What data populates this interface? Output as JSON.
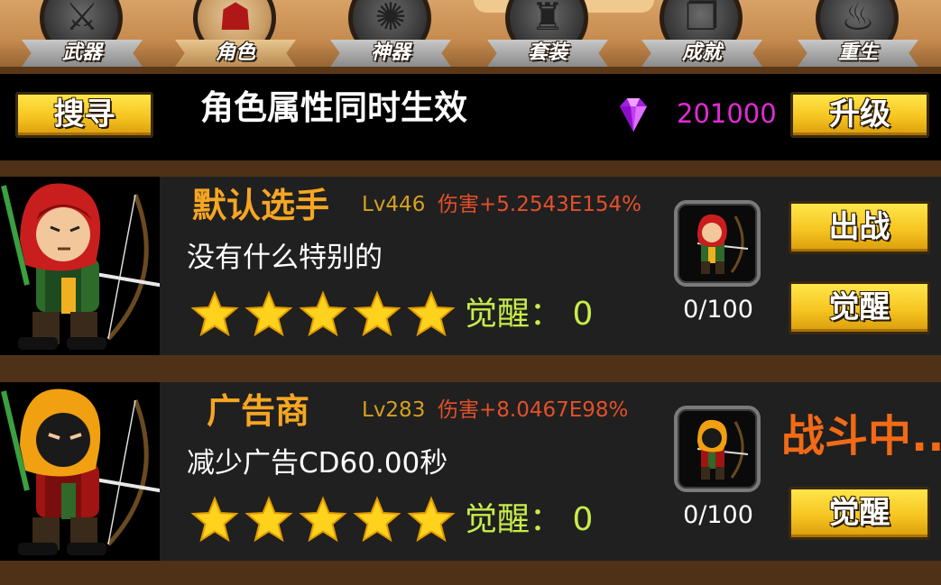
{
  "tabs": [
    {
      "label": "武器",
      "icon": "sword-icon",
      "active": false
    },
    {
      "label": "角色",
      "icon": "archer-icon",
      "active": true
    },
    {
      "label": "神器",
      "icon": "artifact-icon",
      "active": false
    },
    {
      "label": "套装",
      "icon": "helmet-icon",
      "active": false
    },
    {
      "label": "成就",
      "icon": "book-icon",
      "active": false
    },
    {
      "label": "重生",
      "icon": "fire-icon",
      "active": false
    }
  ],
  "header": {
    "search_label": "搜寻",
    "title": "角色属性同时生效",
    "gem_count": "201000",
    "upgrade_label": "升级"
  },
  "characters": [
    {
      "name": "默认选手",
      "level": "Lv446",
      "damage": "伤害+5.2543E154%",
      "description": "没有什么特别的",
      "stars": 5,
      "awaken_text": "觉醒：  0",
      "progress": "0/100",
      "deploy_label": "出战",
      "awaken_label": "觉醒",
      "hood_color": "#c81e1e"
    },
    {
      "name": "广告商",
      "level": "Lv283",
      "damage": "伤害+8.0467E98%",
      "description": "减少广告CD60.00秒",
      "stars": 5,
      "awaken_text": "觉醒：  0",
      "progress": "0/100",
      "status": "战斗中...",
      "awaken_label": "觉醒",
      "hood_color": "#f0a010"
    }
  ],
  "colors": {
    "gem": "#c43cf0",
    "gem_text": "#e22bd6",
    "name": "#f5a623",
    "damage": "#e2502a",
    "awake": "#c8ec4a",
    "button": "#f6c521",
    "status": "#f26a16"
  }
}
